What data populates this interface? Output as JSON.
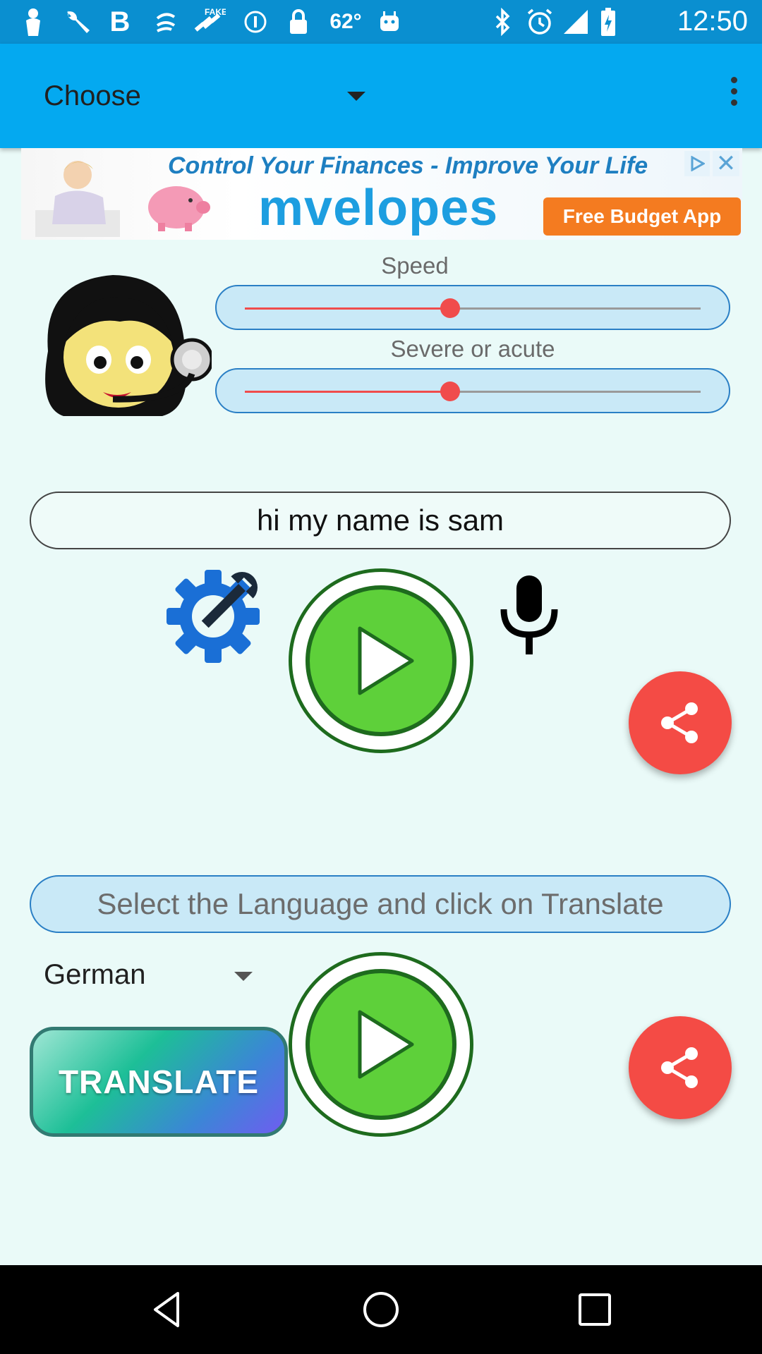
{
  "status_bar": {
    "temperature": "62°",
    "time": "12:50",
    "icons": [
      "person-icon",
      "wrench-icon",
      "bold-b-icon",
      "swirl-icon",
      "fake-gps-icon",
      "info-circle-icon",
      "lock-icon",
      "android-icon",
      "bluetooth-icon",
      "alarm-icon",
      "signal-icon",
      "battery-icon"
    ]
  },
  "app_bar": {
    "dropdown_label": "Choose",
    "icons": [
      "dropdown-arrow-icon",
      "overflow-menu-icon"
    ]
  },
  "ad": {
    "headline": "Control Your Finances - Improve Your Life",
    "brand": "mvelopes",
    "cta": "Free Budget App"
  },
  "controls": {
    "speed_label": "Speed",
    "speed_value": 0.45,
    "pitch_label": "Severe or acute",
    "pitch_value": 0.45
  },
  "input": {
    "text": "hi my name is sam"
  },
  "translation": {
    "instruction": "Select the Language and click on Translate",
    "language": "German",
    "translate_button": "TRANSLATE"
  },
  "colors": {
    "app_bar": "#04a9f0",
    "background": "#eafaf8",
    "accent_red": "#f04c4c",
    "play_green": "#5ed03a",
    "settings_blue": "#1a6fd6"
  }
}
